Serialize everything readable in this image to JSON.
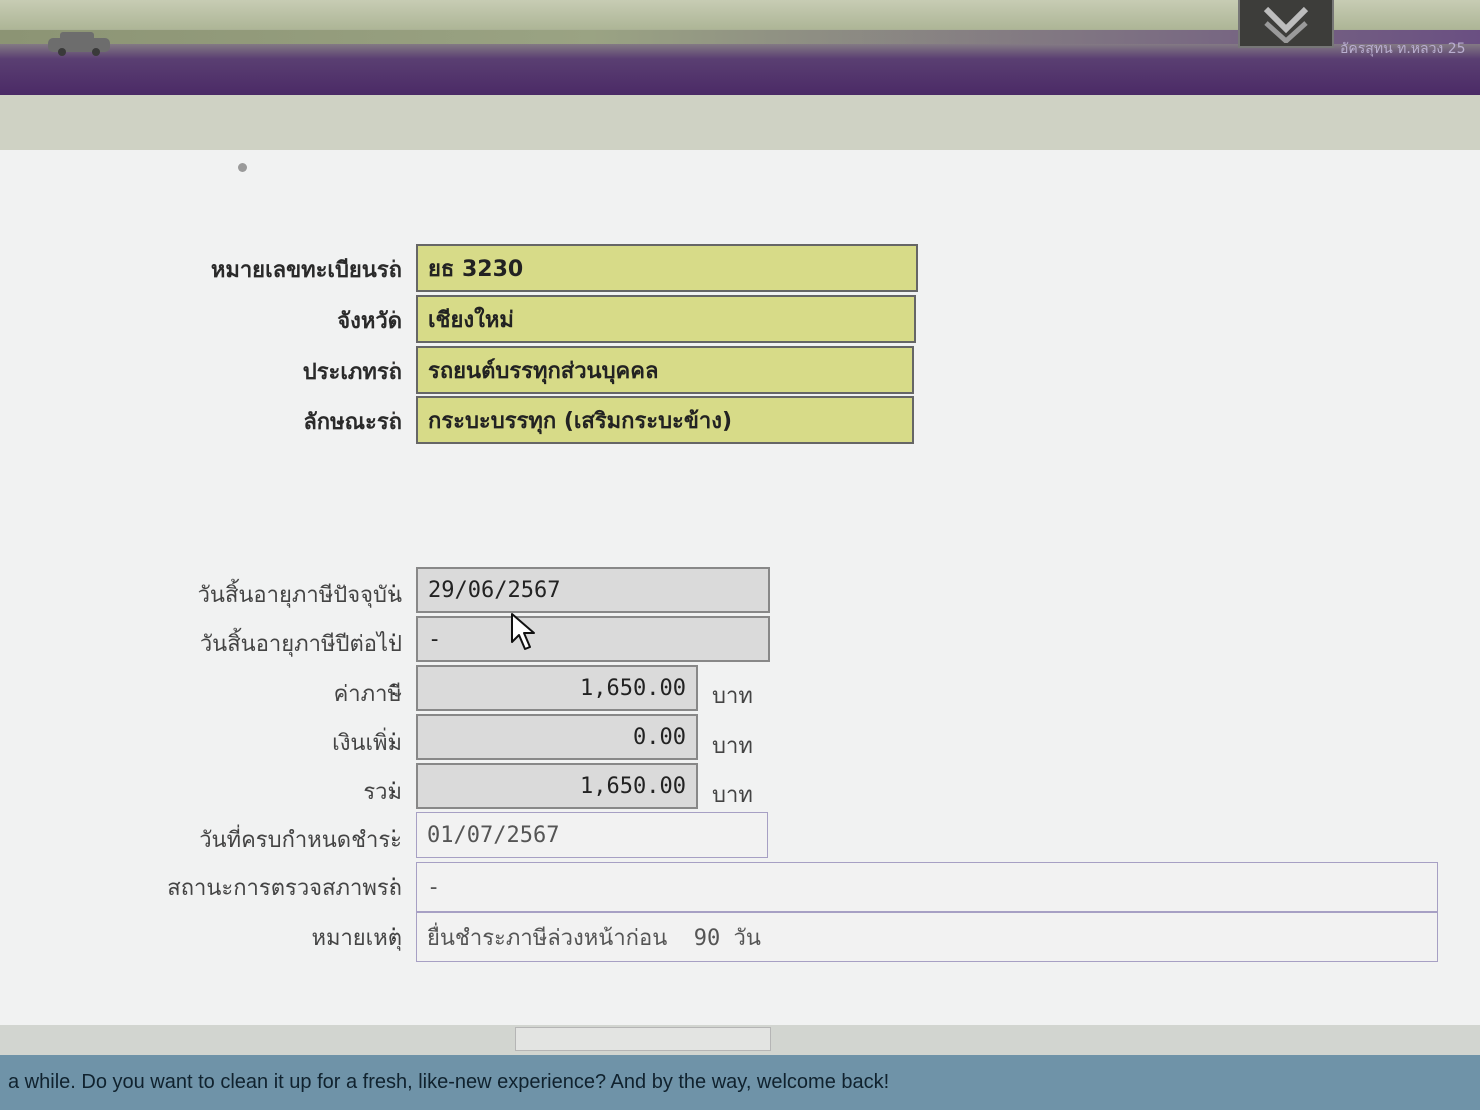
{
  "header": {
    "right_text": "อัครสุทน ท.หลวง 25"
  },
  "vehicle": {
    "plate": {
      "label": "หมายเลขทะเบียนรถ",
      "value": "ยธ 3230"
    },
    "province": {
      "label": "จังหวัด",
      "value": "เชียงใหม่"
    },
    "type": {
      "label": "ประเภทรถ",
      "value": "รถยนต์บรรทุกส่วนบุคคล"
    },
    "style": {
      "label": "ลักษณะรถ",
      "value": "กระบะบรรทุก (เสริมกระบะข้าง)"
    }
  },
  "tax": {
    "current_expiry": {
      "label": "วันสิ้นอายุภาษีปัจจุบัน",
      "value": "29/06/2567"
    },
    "next_expiry": {
      "label": "วันสิ้นอายุภาษีปีต่อไป",
      "value": "-"
    },
    "tax_amount": {
      "label": "ค่าภาษี",
      "value": "1,650.00",
      "unit": "บาท"
    },
    "surcharge": {
      "label": "เงินเพิ่ม",
      "value": "0.00",
      "unit": "บาท"
    },
    "total": {
      "label": "รวม",
      "value": "1,650.00",
      "unit": "บาท"
    },
    "due_date": {
      "label": "วันที่ครบกำหนดชำระ",
      "value": "01/07/2567"
    },
    "inspection_status": {
      "label": "สถานะการตรวจสภาพรถ",
      "value": "-"
    },
    "remark": {
      "label": "หมายเหตุ",
      "value": "ยื่นชำระภาษีล่วงหน้าก่อน  90 วัน"
    }
  },
  "colon": ":",
  "notification": {
    "text": "a while. Do you want to clean it up for a fresh, like-new experience? And by the way, welcome back!"
  }
}
